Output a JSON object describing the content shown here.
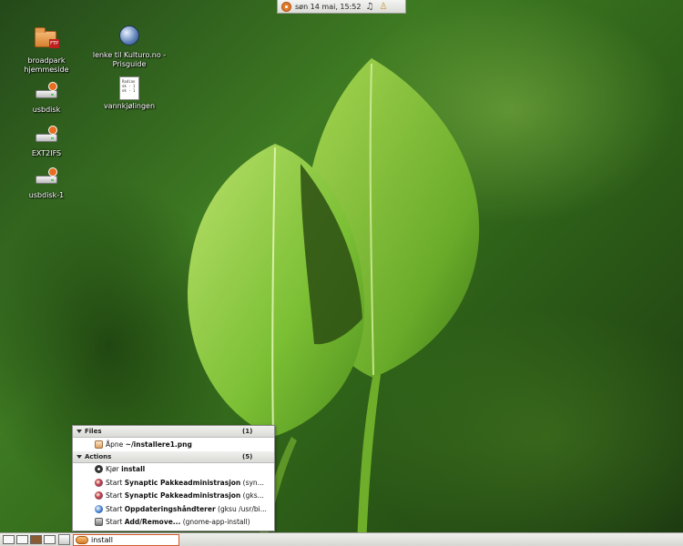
{
  "top_panel": {
    "clock": "søn 14 mai, 15:52",
    "icons": [
      "ubuntu-logo-icon",
      "music-note-icon",
      "user-icon"
    ]
  },
  "desktop_icons": [
    {
      "label": "broadpark hjemmeside",
      "icon": "ftp-folder-icon"
    },
    {
      "label": "lenke til Kulturo.no - Prisguide",
      "icon": "globe-link-icon"
    },
    {
      "label": "usbdisk",
      "icon": "removable-drive-icon"
    },
    {
      "label": "vannkjølingen",
      "icon": "text-document-icon"
    },
    {
      "label": "EXT2IFS",
      "icon": "removable-drive-icon"
    },
    {
      "label": "usbdisk-1",
      "icon": "removable-drive-icon"
    }
  ],
  "doc_preview": [
    "Radian",
    "ok - 1",
    "ok - 1"
  ],
  "deskbar": {
    "files": {
      "header": "Files",
      "count": "(1)",
      "items": [
        {
          "prefix": "Åpne ",
          "bold": "~/installere1.png",
          "suffix": ""
        }
      ]
    },
    "actions": {
      "header": "Actions",
      "count": "(5)",
      "items": [
        {
          "prefix": "Kjør ",
          "bold": "install",
          "suffix": ""
        },
        {
          "prefix": "Start ",
          "bold": "Synaptic Pakkeadministrasjon",
          "suffix": " (syn..."
        },
        {
          "prefix": "Start ",
          "bold": "Synaptic Pakkeadministrasjon",
          "suffix": " (gks..."
        },
        {
          "prefix": "Start ",
          "bold": "Oppdateringshåndterer",
          "suffix": " (gksu /usr/bi..."
        },
        {
          "prefix": "Start ",
          "bold": "Add/Remove...",
          "suffix": " (gnome-app-install)"
        }
      ]
    }
  },
  "bottom_panel": {
    "search_value": "install",
    "workspaces": 4,
    "active_workspace": 3
  },
  "colors": {
    "accent": "#d2572a",
    "panel": "#e4e4e0",
    "wallpaper_green": "#3e7a22"
  }
}
